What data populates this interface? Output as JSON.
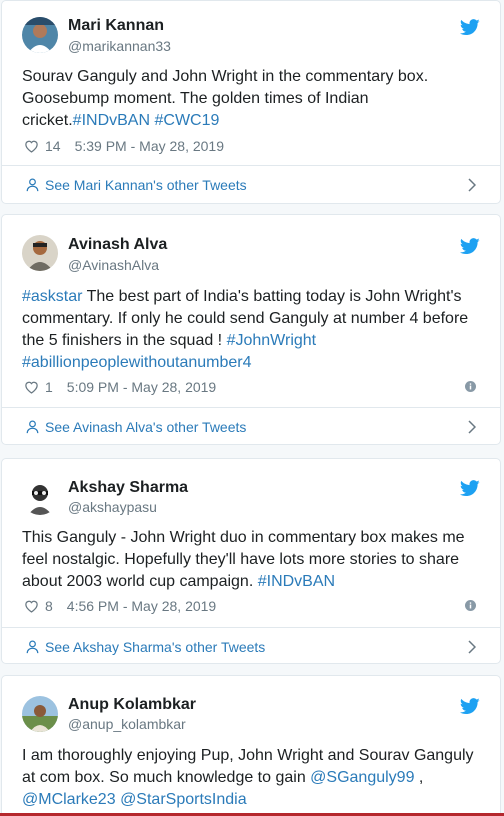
{
  "colors": {
    "link": "#2b7bb9",
    "twitter_blue": "#1da1f2",
    "meta_gray": "#697882"
  },
  "tweets": [
    {
      "name": "Mari Kannan",
      "handle": "@marikannan33",
      "text_parts": [
        "Sourav Ganguly and John Wright in the commentary box. Goosebump moment. The golden times of Indian cricket.",
        "#INDvBAN",
        " ",
        "#CWC19"
      ],
      "likes": "14",
      "timestamp": "5:39 PM - May 28, 2019",
      "footer": "See Mari Kannan's other Tweets",
      "avatar_icon": "avatar-photo"
    },
    {
      "name": "Avinash Alva",
      "handle": "@AvinashAlva",
      "text_parts": [
        "#askstar",
        " The best part of India's batting today is John Wright's commentary. If only he could send Ganguly at number 4 before the 5 finishers in the squad ! ",
        "#JohnWright",
        " ",
        "#abillionpeoplewithoutanumber4"
      ],
      "likes": "1",
      "timestamp": "5:09 PM - May 28, 2019",
      "footer": "See Avinash Alva's other Tweets",
      "avatar_icon": "avatar-photo"
    },
    {
      "name": "Akshay Sharma",
      "handle": "@akshaypasu",
      "text_parts": [
        "This Ganguly - John Wright duo in commentary box makes me feel nostalgic. Hopefully they'll have lots more stories to share about 2003 world cup campaign. ",
        "#INDvBAN"
      ],
      "likes": "8",
      "timestamp": "4:56 PM - May 28, 2019",
      "footer": "See Akshay Sharma's other Tweets",
      "avatar_icon": "avatar-cartoon"
    },
    {
      "name": "Anup Kolambkar",
      "handle": "@anup_kolambkar",
      "text_parts": [
        "I am thoroughly enjoying Pup, John Wright and Sourav Ganguly at com box. So much knowledge to gain ",
        "@SGanguly99",
        " ,",
        "@MClarke23",
        " ",
        "@StarSportsIndia"
      ],
      "avatar_icon": "avatar-photo"
    }
  ]
}
